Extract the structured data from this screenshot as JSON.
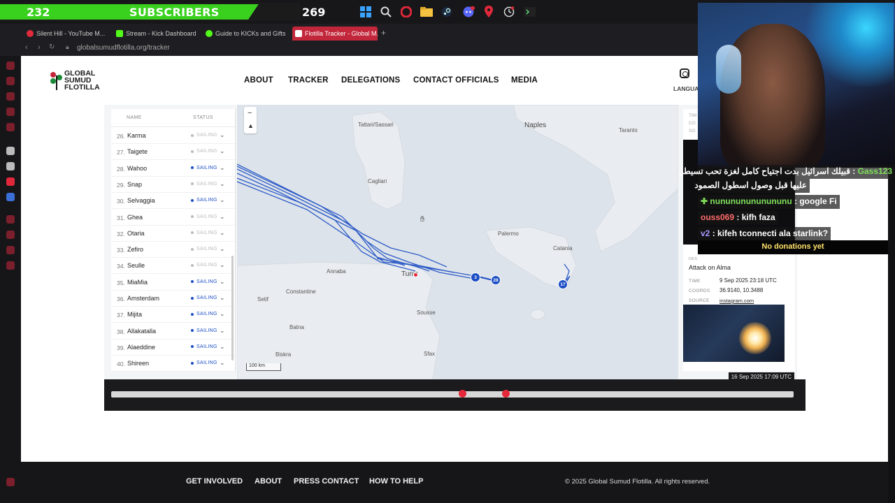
{
  "taskbar": {
    "subscriber_count": "232",
    "subscriber_label": "SUBSCRIBERS",
    "subscriber_goal": "269",
    "subscriber_progress": 0.86,
    "discord_badge": "9+"
  },
  "browser": {
    "tabs": [
      {
        "label": "Silent Hill - YouTube M...",
        "color": "#e02b3c"
      },
      {
        "label": "Stream - Kick Dashboard",
        "color": "#53fc18"
      },
      {
        "label": "Guide to KICKs and Gifts",
        "color": "#53fc18"
      },
      {
        "label": "Flotilla Tracker - Global M...",
        "color": "#c2263a",
        "active": true
      }
    ],
    "new_tab": "+",
    "url": "globalsumudflotilla.org/tracker"
  },
  "site": {
    "logo_lines": [
      "GLOBAL",
      "SUMUD",
      "FLOTILLA"
    ],
    "nav": [
      "ABOUT",
      "TRACKER",
      "DELEGATIONS",
      "CONTACT OFFICIALS",
      "MEDIA"
    ],
    "language_label": "LANGUA"
  },
  "vessel_list": {
    "header_name": "NAME",
    "header_status": "STATUS",
    "rows": [
      {
        "num": "26.",
        "name": "Karma",
        "status": "SAILING",
        "active": false
      },
      {
        "num": "27.",
        "name": "Taigete",
        "status": "SAILING",
        "active": false
      },
      {
        "num": "28.",
        "name": "Wahoo",
        "status": "SAILING",
        "active": true
      },
      {
        "num": "29.",
        "name": "Snap",
        "status": "SAILING",
        "active": false
      },
      {
        "num": "30.",
        "name": "Selvaggia",
        "status": "SAILING",
        "active": true
      },
      {
        "num": "31.",
        "name": "Ghea",
        "status": "SAILING",
        "active": false
      },
      {
        "num": "32.",
        "name": "Otaria",
        "status": "SAILING",
        "active": false
      },
      {
        "num": "33.",
        "name": "Zefiro",
        "status": "SAILING",
        "active": false
      },
      {
        "num": "34.",
        "name": "Seulle",
        "status": "SAILING",
        "active": false
      },
      {
        "num": "35.",
        "name": "MiaMia",
        "status": "SAILING",
        "active": true
      },
      {
        "num": "36.",
        "name": "Amsterdam",
        "status": "SAILING",
        "active": true
      },
      {
        "num": "37.",
        "name": "Mijita",
        "status": "SAILING",
        "active": true
      },
      {
        "num": "38.",
        "name": "Allakatalla",
        "status": "SAILING",
        "active": true
      },
      {
        "num": "39.",
        "name": "Alaeddine",
        "status": "SAILING",
        "active": true
      },
      {
        "num": "40.",
        "name": "Shireen",
        "status": "SAILING",
        "active": true
      }
    ]
  },
  "map": {
    "labels": {
      "sassari": "Tattari/Sassari",
      "naples": "Naples",
      "taranto": "Taranto",
      "cagliari": "Cagliari",
      "palermo": "Palermo",
      "catania": "Catania",
      "annaba": "Annaba",
      "tunis": "Tunis",
      "constantine": "Constantine",
      "setif": "Setif",
      "batna": "Batna",
      "sousse": "Sousse",
      "sfax": "Sfax",
      "biskra": "Biskra"
    },
    "scale": "100 km",
    "badges": [
      "3",
      "28",
      "17"
    ],
    "zoom_out": "−"
  },
  "event": {
    "top_labels": [
      "TIM",
      "CO",
      "SO"
    ],
    "label": "DES",
    "title": "Attack on Alma",
    "time_key": "TIME",
    "time": "9 Sep 2025 23:18 UTC",
    "coords_key": "COORDS",
    "coords": "36.9140, 10.3488",
    "source_key": "SOURCE",
    "source": "instagram.com"
  },
  "timeline": {
    "timestamp": "16 Sep 2025 17:09 UTC",
    "handle_a": 0.514,
    "handle_b": 0.578
  },
  "footer": {
    "links": [
      "GET INVOLVED",
      "ABOUT",
      "PRESS CONTACT",
      "HOW TO HELP"
    ],
    "copyright": "© 2025 Global Sumud Flotilla. All rights reserved."
  },
  "chat": {
    "messages": [
      {
        "user": "Gass123",
        "text": " : قبيلك اسرائيل بدت اجتياح كامل لغزة تحب تسيطر",
        "color": "green"
      },
      {
        "user": "",
        "text": "عليها قبل وصول اسطول الصمود",
        "color": "none"
      },
      {
        "user": "nunununununununu",
        "text": " : google Fi",
        "color": "green"
      },
      {
        "user": "ouss069",
        "text": " : kifh faza",
        "color": "red"
      },
      {
        "user": "v2",
        "text": " : kifeh tconnecti ala starlink?",
        "color": "purple"
      }
    ],
    "donations": "No donations yet"
  },
  "colors": {
    "brand_red": "#c2263a",
    "route_blue": "#1c4ec4",
    "subs_green": "#39d11e"
  }
}
